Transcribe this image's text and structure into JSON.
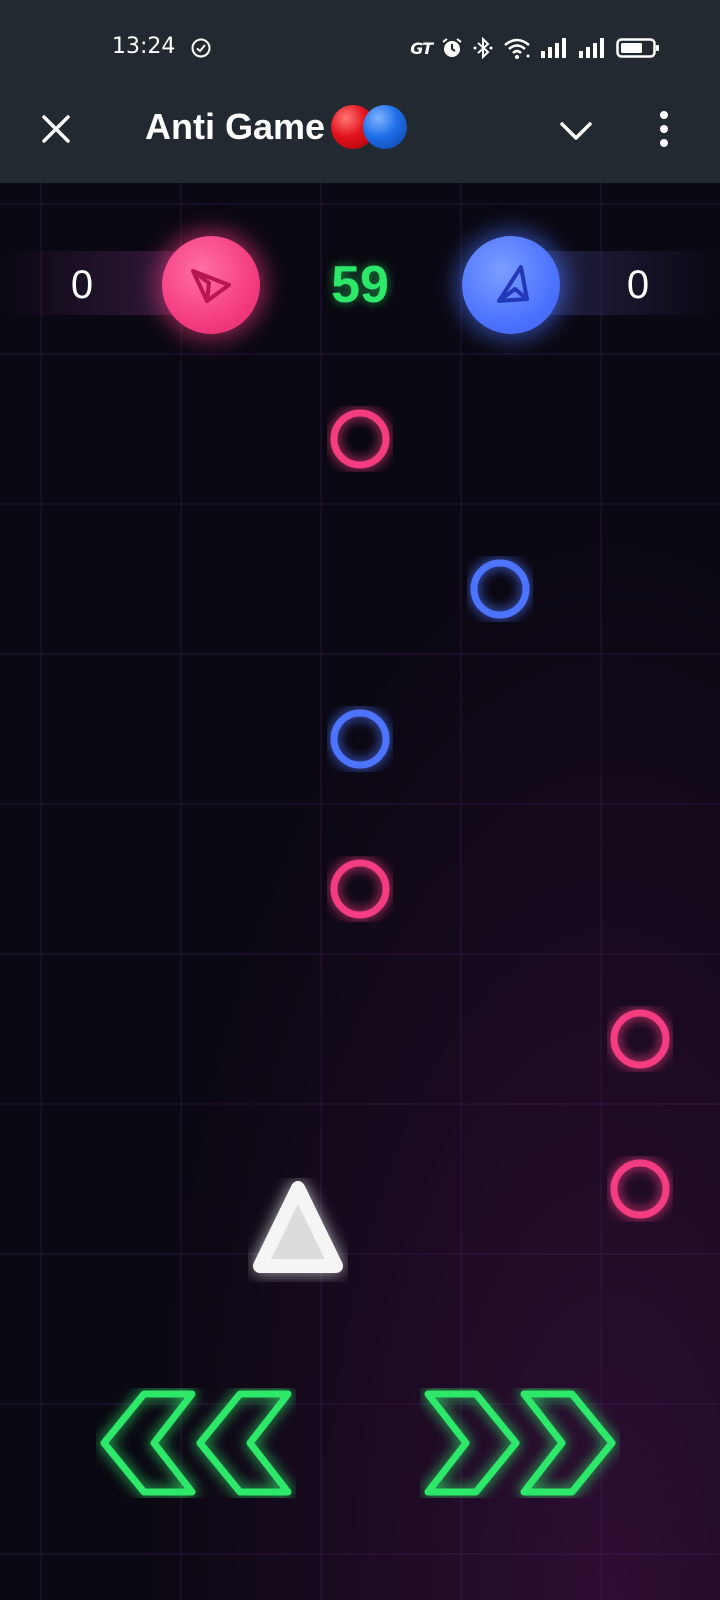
{
  "status_bar": {
    "time": "13:24",
    "gt_label": "GT",
    "icons": [
      "check-circle-icon",
      "alarm-icon",
      "bluetooth-icon",
      "wifi-icon",
      "signal-icon",
      "signal-icon",
      "battery-icon"
    ]
  },
  "app_bar": {
    "title": "Anti Game",
    "title_emoji": [
      "red-circle",
      "blue-circle"
    ],
    "icons": [
      "close-icon",
      "chevron-down-icon",
      "more-vert-icon"
    ]
  },
  "game": {
    "pink_score": "0",
    "blue_score": "0",
    "timer": "59",
    "colors": {
      "pink": "#f43d80",
      "blue": "#4d74ff",
      "green": "#2ee86a",
      "background": "#0a0812",
      "bar": "#222930"
    },
    "rings": [
      {
        "color": "pink",
        "lane": "center"
      },
      {
        "color": "blue",
        "lane": "right-center"
      },
      {
        "color": "blue",
        "lane": "center"
      },
      {
        "color": "pink",
        "lane": "center"
      },
      {
        "color": "pink",
        "lane": "right"
      },
      {
        "color": "pink",
        "lane": "right"
      }
    ],
    "controls": [
      "move-left",
      "move-right"
    ]
  }
}
